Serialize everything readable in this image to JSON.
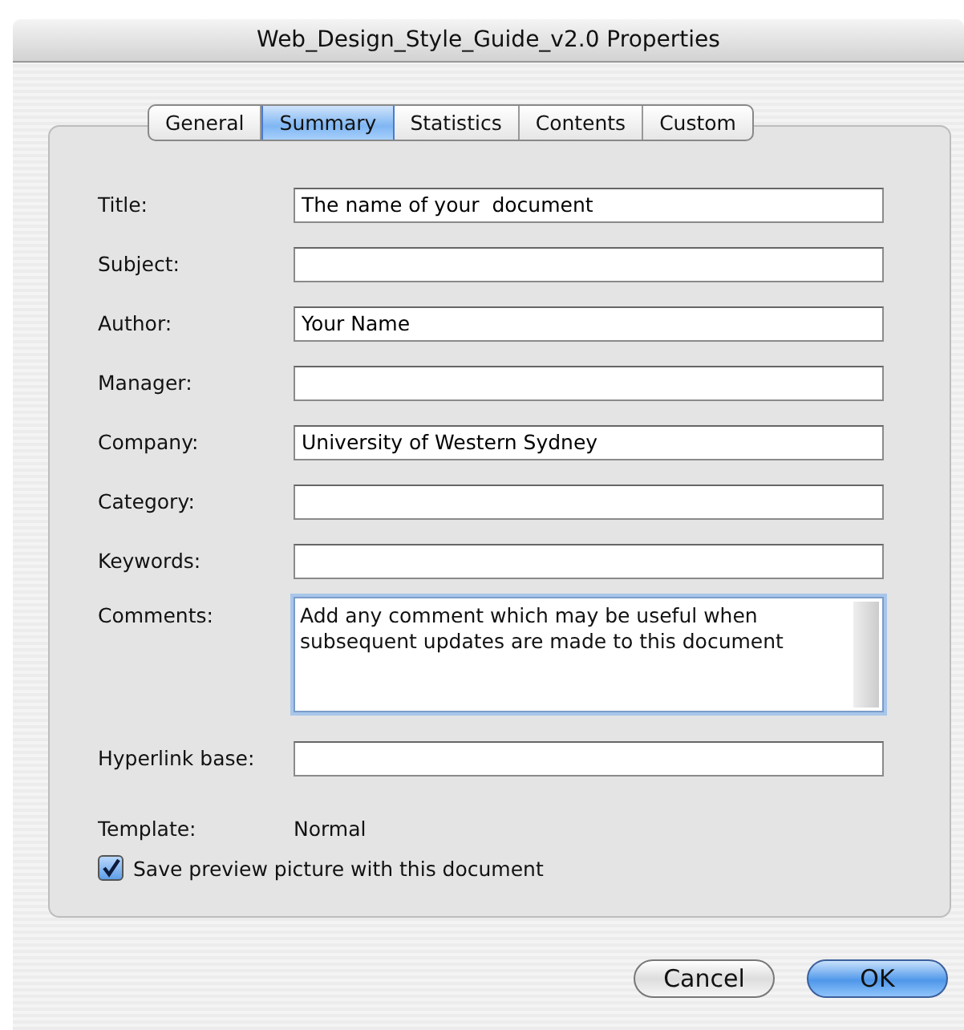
{
  "window": {
    "title": "Web_Design_Style_Guide_v2.0 Properties"
  },
  "tabs": [
    {
      "label": "General",
      "selected": false
    },
    {
      "label": "Summary",
      "selected": true
    },
    {
      "label": "Statistics",
      "selected": false
    },
    {
      "label": "Contents",
      "selected": false
    },
    {
      "label": "Custom",
      "selected": false
    }
  ],
  "fields": [
    {
      "kind": "line",
      "label": "Title:",
      "value": "The name of your  document"
    },
    {
      "kind": "line",
      "label": "Subject:"
    },
    {
      "kind": "line",
      "label": "Author:",
      "value": "Your Name"
    },
    {
      "kind": "line",
      "label": "Manager:"
    },
    {
      "kind": "line",
      "label": "Company:",
      "value": "University of Western Sydney"
    },
    {
      "kind": "line",
      "label": "Category:"
    },
    {
      "kind": "line",
      "label": "Keywords:"
    },
    {
      "kind": "multiline",
      "label": "Comments:",
      "value": "Add any comment which may be useful when subsequent updates are made to this document"
    },
    {
      "kind": "line",
      "label": "Hyperlink base:"
    }
  ],
  "template": {
    "label": "Template:",
    "value": "Normal"
  },
  "save_preview": {
    "label": "Save preview picture with this document",
    "checked": true
  },
  "buttons": [
    {
      "label": "Cancel",
      "default": false
    },
    {
      "label": "OK",
      "default": true
    }
  ]
}
